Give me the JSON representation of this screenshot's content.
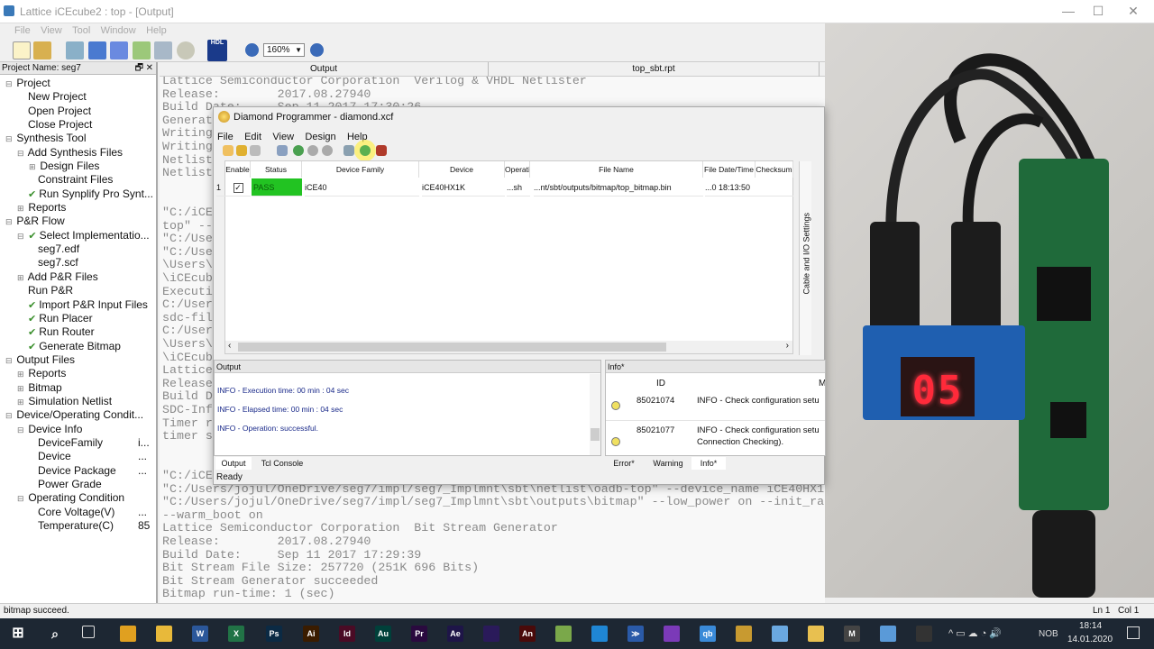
{
  "window": {
    "title": "Lattice iCEcube2 : top - [Output]",
    "minimize": "—",
    "maximize": "☐",
    "close": "✕"
  },
  "menu": [
    "File",
    "View",
    "Tool",
    "Window",
    "Help"
  ],
  "toolbar": {
    "zoom": "160%",
    "hdl_label": "HDL"
  },
  "project": {
    "header": "Project Name: seg7",
    "tree": [
      {
        "label": "Project",
        "level": 0,
        "exp": "⊟"
      },
      {
        "label": "New Project",
        "level": 1
      },
      {
        "label": "Open Project",
        "level": 1
      },
      {
        "label": "Close Project",
        "level": 1
      },
      {
        "label": "Synthesis Tool",
        "level": 0,
        "exp": "⊟"
      },
      {
        "label": "Add Synthesis Files",
        "level": 1,
        "exp": "⊟"
      },
      {
        "label": "Design Files",
        "level": 2,
        "exp": "⊞"
      },
      {
        "label": "Constraint Files",
        "level": 2
      },
      {
        "label": "Run Synplify Pro Synt...",
        "level": 1,
        "check": true
      },
      {
        "label": "Reports",
        "level": 1,
        "exp": "⊞"
      },
      {
        "label": "P&R Flow",
        "level": 0,
        "exp": "⊟"
      },
      {
        "label": "Select Implementatio...",
        "level": 1,
        "exp": "⊟",
        "check": true
      },
      {
        "label": "seg7.edf",
        "level": 2
      },
      {
        "label": "seg7.scf",
        "level": 2
      },
      {
        "label": "Add P&R Files",
        "level": 1,
        "exp": "⊞"
      },
      {
        "label": "Run P&R",
        "level": 1
      },
      {
        "label": "Import P&R Input Files",
        "level": 1,
        "check": true
      },
      {
        "label": "Run Placer",
        "level": 1,
        "check": true
      },
      {
        "label": "Run Router",
        "level": 1,
        "check": true
      },
      {
        "label": "Generate Bitmap",
        "level": 1,
        "check": true
      },
      {
        "label": "Output Files",
        "level": 0,
        "exp": "⊟"
      },
      {
        "label": "Reports",
        "level": 1,
        "exp": "⊞"
      },
      {
        "label": "Bitmap",
        "level": 1,
        "exp": "⊞"
      },
      {
        "label": "Simulation Netlist",
        "level": 1,
        "exp": "⊞"
      },
      {
        "label": "Device/Operating Condit...",
        "level": 0,
        "exp": "⊟"
      },
      {
        "label": "Device Info",
        "level": 1,
        "exp": "⊟"
      },
      {
        "label": "DeviceFamily",
        "level": 2,
        "value": "i..."
      },
      {
        "label": "Device",
        "level": 2,
        "value": "..."
      },
      {
        "label": "Device Package",
        "level": 2,
        "value": "..."
      },
      {
        "label": "Power Grade",
        "level": 2
      },
      {
        "label": "Operating Condition",
        "level": 1,
        "exp": "⊟"
      },
      {
        "label": "Core Voltage(V)",
        "level": 2,
        "value": "..."
      },
      {
        "label": "Temperature(C)",
        "level": 2,
        "value": "85"
      }
    ]
  },
  "output_tabs": [
    "Output",
    "top_sbt.rpt"
  ],
  "console": [
    "Lattice Semiconductor Corporation  Verilog & VHDL Netlister",
    "Release:        2017.08.27940",
    "Build Date:     Sep 11 2017 17:30:26",
    "Generat",
    "Writing",
    "Writing",
    "Netlist",
    "Netlist",
    "",
    "",
    "\"C:/iCE",
    "top\" --",
    "\"C:/Use",
    "\"C:/Use",
    "\\Users\\",
    "\\iCEcub",
    "Executi",
    "C:/User",
    "sdc-fil",
    "C:/User",
    "\\Users\\",
    "\\iCEcub",
    "Lattice",
    "Release",
    "Build D",
    "SDC-Inf",
    "Timer r",
    "timer s",
    "",
    "",
    "\"C:/iCE",
    "\"C:/Users/jojul/OneDrive/seg7/impl/seg7_Implmnt\\sbt\\netlist\\oadb-top\" --device_name iCE40HX1",
    "\"C:/Users/jojul/OneDrive/seg7/impl/seg7_Implmnt\\sbt\\outputs\\bitmap\" --low_power on --init_ra",
    "--warm_boot on",
    "Lattice Semiconductor Corporation  Bit Stream Generator",
    "Release:        2017.08.27940",
    "Build Date:     Sep 11 2017 17:29:39",
    "Bit Stream File Size: 257720 (251K 696 Bits)",
    "Bit Stream Generator succeeded",
    "Bitmap run-time: 1 (sec)"
  ],
  "programmer": {
    "title": "Diamond Programmer - diamond.xcf",
    "menu": [
      "File",
      "Edit",
      "View",
      "Design",
      "Help"
    ],
    "columns": [
      "Enable",
      "Status",
      "Device Family",
      "Device",
      "Operatic",
      "File Name",
      "File Date/Time",
      "Checksum"
    ],
    "rows": [
      {
        "index": "1",
        "enabled": true,
        "status": "PASS",
        "family": "iCE40",
        "device": "iCE40HX1K",
        "operation": "...sh",
        "file": "...nt/sbt/outputs/bitmap/top_bitmap.bin",
        "date": "...0 18:13:50",
        "checksum": ""
      }
    ],
    "side_tab": "Cable and I/O Settings",
    "output": {
      "title": "Output",
      "lines": [
        "INFO - Execution time: 00 min : 04 sec",
        "INFO - Elapsed time: 00 min : 04 sec",
        "INFO - Operation: successful."
      ]
    },
    "info": {
      "title": "Info*",
      "col_id": "ID",
      "col_msg": "M",
      "rows": [
        {
          "id": "85021074",
          "msg": "INFO - Check configuration setu"
        },
        {
          "id": "85021077",
          "msg": "INFO - Check configuration setu",
          "msg2": "Connection Checking)."
        }
      ]
    },
    "bottom_tabs_left": [
      "Output",
      "Tcl Console"
    ],
    "bottom_tabs_right": [
      "Error*",
      "Warning",
      "Info*"
    ],
    "status": "Ready",
    "pass_color": "#22c322"
  },
  "photo": {
    "display": "05"
  },
  "statusbar": {
    "message": "bitmap succeed.",
    "ln": "Ln 1",
    "col": "Col 1"
  },
  "taskbar": {
    "apps": [
      {
        "name": "chrome",
        "label": "",
        "color": "#e0a020"
      },
      {
        "name": "explorer",
        "label": "",
        "color": "#e8b93a"
      },
      {
        "name": "word",
        "label": "W",
        "color": "#2b579a"
      },
      {
        "name": "excel",
        "label": "X",
        "color": "#217346"
      },
      {
        "name": "photoshop",
        "label": "Ps",
        "color": "#0b2a44"
      },
      {
        "name": "illustrator",
        "label": "Ai",
        "color": "#3a1c00"
      },
      {
        "name": "indesign",
        "label": "Id",
        "color": "#4a0b25"
      },
      {
        "name": "audition",
        "label": "Au",
        "color": "#00403a"
      },
      {
        "name": "premiere",
        "label": "Pr",
        "color": "#2a0a3f"
      },
      {
        "name": "after-effects",
        "label": "Ae",
        "color": "#1e1548"
      },
      {
        "name": "media-encoder",
        "label": "",
        "color": "#2a1a5a"
      },
      {
        "name": "animate",
        "label": "An",
        "color": "#4a0a0a"
      },
      {
        "name": "notepad",
        "label": "",
        "color": "#7aa84a"
      },
      {
        "name": "vscode",
        "label": "",
        "color": "#1f86d4"
      },
      {
        "name": "powershell",
        "label": "≫",
        "color": "#2a5aa8"
      },
      {
        "name": "app-arc",
        "label": "",
        "color": "#7b3ab8"
      },
      {
        "name": "qbittorrent",
        "label": "qb",
        "color": "#3a8ad8"
      },
      {
        "name": "app-folder",
        "label": "",
        "color": "#c89a30"
      },
      {
        "name": "app-cube",
        "label": "",
        "color": "#6aa8e0"
      },
      {
        "name": "diamond-programmer",
        "label": "",
        "color": "#e8c050"
      },
      {
        "name": "app-m",
        "label": "M",
        "color": "#444"
      },
      {
        "name": "app-cube2",
        "label": "",
        "color": "#5a9ad8"
      },
      {
        "name": "obs",
        "label": "",
        "color": "#333"
      }
    ],
    "lang": "NOB",
    "time": "18:14",
    "date": "14.01.2020"
  }
}
